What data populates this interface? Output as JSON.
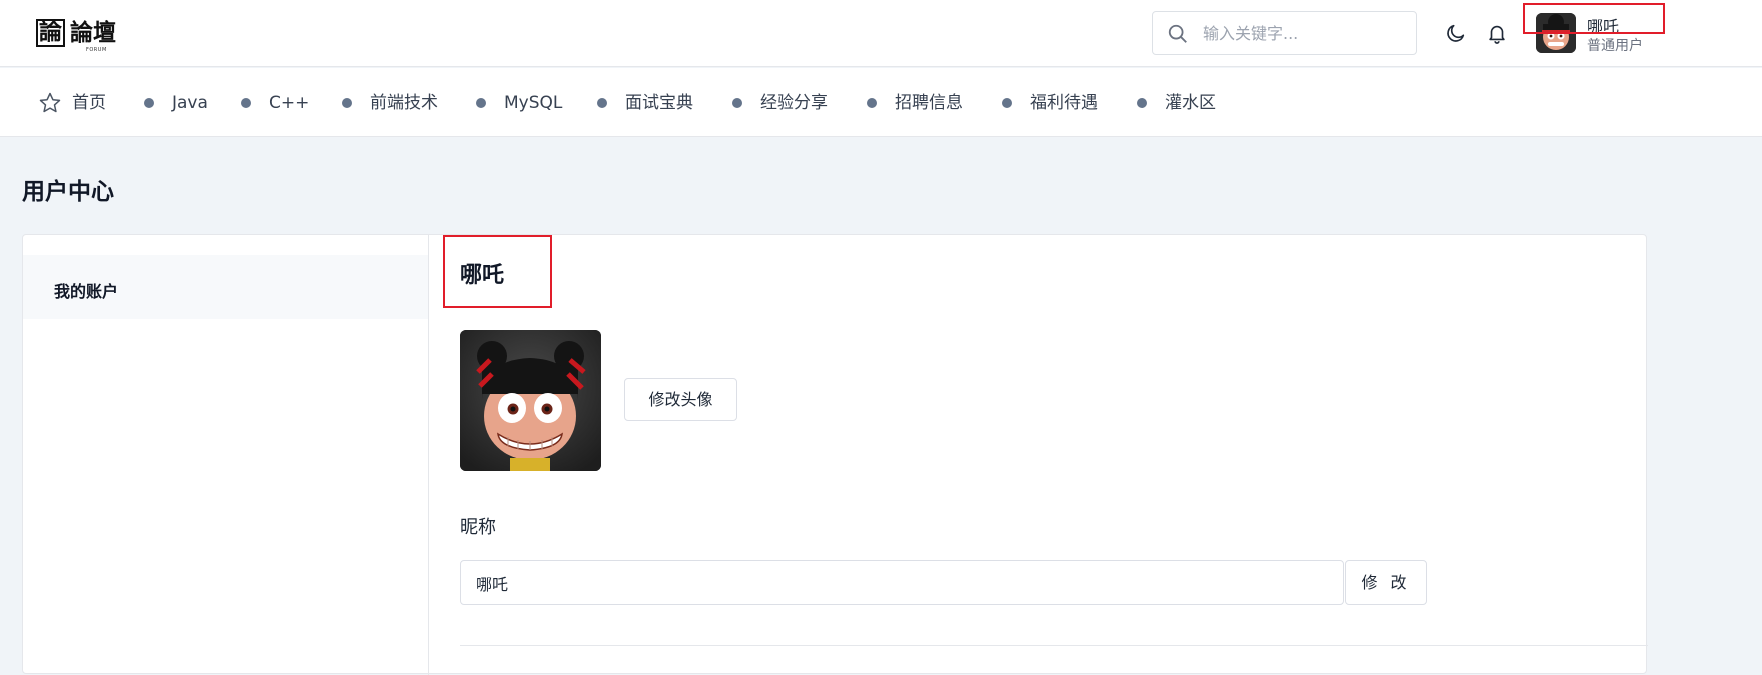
{
  "header": {
    "logo": {
      "mark": "論",
      "text": "論壇",
      "sub": "FORUM"
    },
    "search": {
      "placeholder": "输入关键字..."
    },
    "user": {
      "name": "哪吒",
      "role": "普通用户"
    }
  },
  "nav": {
    "items": [
      {
        "label": "首页",
        "icon": "star-icon"
      },
      {
        "label": "Java"
      },
      {
        "label": "C++"
      },
      {
        "label": "前端技术"
      },
      {
        "label": "MySQL"
      },
      {
        "label": "面试宝典"
      },
      {
        "label": "经验分享"
      },
      {
        "label": "招聘信息"
      },
      {
        "label": "福利待遇"
      },
      {
        "label": "灌水区"
      }
    ]
  },
  "page": {
    "title": "用户中心",
    "sidebar": {
      "items": [
        {
          "label": "我的账户",
          "active": true
        }
      ]
    },
    "profile": {
      "name": "哪吒",
      "change_avatar_label": "修改头像",
      "nickname_label": "昵称",
      "nickname_value": "哪吒",
      "modify_label": "修 改"
    }
  },
  "colors": {
    "highlight_box": "#e11d2a",
    "page_bg": "#f0f4f8",
    "nav_dot": "#64748b"
  }
}
